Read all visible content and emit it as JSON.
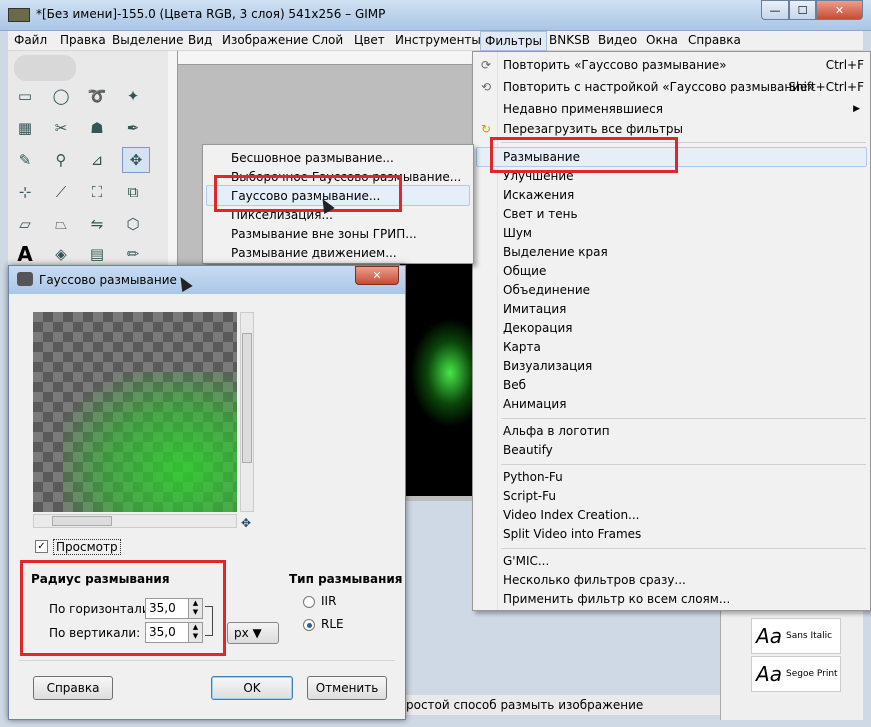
{
  "window": {
    "title": "*[Без имени]-155.0 (Цвета RGB, 3 слоя) 541x256 – GIMP",
    "min": "—",
    "max": "☐",
    "close": "✕"
  },
  "menubar": {
    "items": [
      "Файл",
      "Правка",
      "Выделение",
      "Вид",
      "Изображение",
      "Слой",
      "Цвет",
      "Инструменты",
      "Фильтры",
      "BNKSB",
      "Видео",
      "Окна",
      "Справка"
    ],
    "active": "Фильтры"
  },
  "filters_menu": {
    "repeat": "Повторить «Гауссово размывание»",
    "repeat_shortcut": "Ctrl+F",
    "reshow": "Повторить с настройкой «Гауссово размывание»",
    "reshow_shortcut": "Shift+Ctrl+F",
    "recent": "Недавно применявшиеся",
    "reload": "Перезагрузить все фильтры",
    "items_group1": [
      "Размывание",
      "Улучшение",
      "Искажения",
      "Свет и тень",
      "Шум",
      "Выделение края",
      "Общие",
      "Объединение",
      "Имитация",
      "Декорация",
      "Карта",
      "Визуализация",
      "Веб",
      "Анимация"
    ],
    "items_group2": [
      "Альфа в логотип",
      "Beautify"
    ],
    "items_group3": [
      "Python-Fu",
      "Script-Fu",
      "Video Index Creation...",
      "Split Video into Frames"
    ],
    "items_group4": [
      "G'MIC...",
      "Несколько фильтров сразу...",
      "Применить фильтр ко всем слоям..."
    ]
  },
  "blur_submenu": {
    "items": [
      "Бесшовное размывание...",
      "Выборочное Гауссово размывание...",
      "Гауссово размывание...",
      "Пикселизация...",
      "Размывание вне зоны ГРИП...",
      "Размывание движением..."
    ],
    "highlighted": "Гауссово размывание..."
  },
  "dialog": {
    "title": "Гауссово размывание",
    "close": "✕",
    "preview_label": "Просмотр",
    "preview_checked": true,
    "radius_title": "Радиус размывания",
    "horizontal_label": "По горизонтали:",
    "horizontal_value": "35,0",
    "vertical_label": "По вертикали:",
    "vertical_value": "35,0",
    "unit": "px",
    "type_title": "Тип размывания",
    "type_options": [
      "IIR",
      "RLE"
    ],
    "type_selected": "RLE",
    "help_button": "Справка",
    "ok_button": "OK",
    "cancel_button": "Отменить"
  },
  "fonts_dock": {
    "items": [
      {
        "sample": "Aa",
        "name": "Sans Italic"
      },
      {
        "sample": "Aa",
        "name": "Segoe Print"
      }
    ]
  },
  "statusbar": {
    "text": "ростой способ размыть изображение"
  },
  "colors": {
    "highlight_border": "#e0262a",
    "accent": "#3c7fb1"
  }
}
